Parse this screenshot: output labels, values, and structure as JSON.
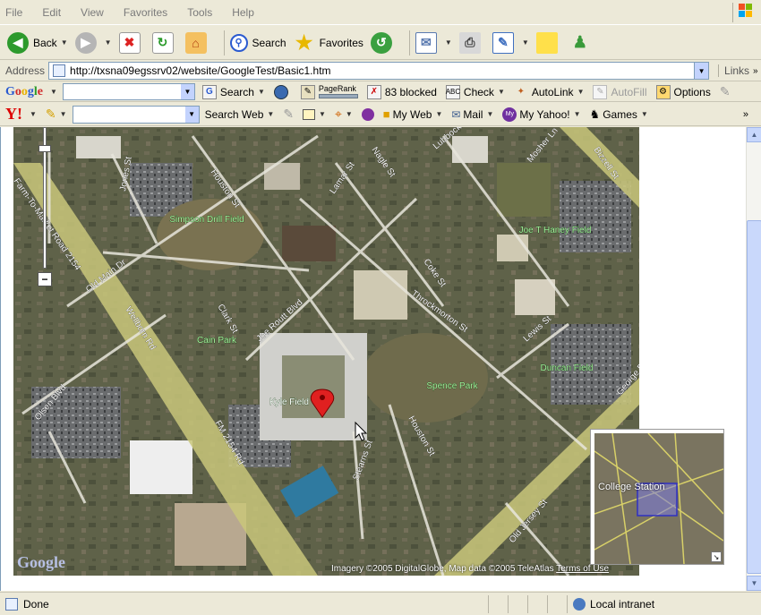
{
  "menu": [
    "File",
    "Edit",
    "View",
    "Favorites",
    "Tools",
    "Help"
  ],
  "toolbar": {
    "back_label": "Back",
    "search_label": "Search",
    "favorites_label": "Favorites"
  },
  "address": {
    "label": "Address",
    "url": "http://txsna09egssrv02/website/GoogleTest/Basic1.htm",
    "links_label": "Links"
  },
  "google_toolbar": {
    "logo": "Google",
    "search_label": "Search",
    "pagerank_label": "PageRank",
    "blocked_label": "83 blocked",
    "check_label": "Check",
    "autolink_label": "AutoLink",
    "autofill_label": "AutoFill",
    "options_label": "Options"
  },
  "yahoo_toolbar": {
    "logo": "Y!",
    "search_web_label": "Search Web",
    "my_web_label": "My Web",
    "mail_label": "Mail",
    "my_yahoo_label": "My Yahoo!",
    "games_label": "Games"
  },
  "map": {
    "streets": [
      "Houston St",
      "Jones St",
      "Nagle St",
      "Lubbock",
      "Mosher Ln",
      "Bizzell St",
      "Lamar St",
      "Farm-To-Market Road 2154",
      "Old Main Dr",
      "Coke St",
      "Throckmorton St",
      "Joe Routt Blvd",
      "Clark St",
      "Wellborn Rd",
      "Lewis St",
      "Olsen Blvd",
      "FM 2154 Rd",
      "Stearns St",
      "Houston St",
      "Old Jersey St",
      "George Bush Dr"
    ],
    "places": [
      "Simpson Drill Field",
      "Joe T Haney Field",
      "Cain Park",
      "Kyle Field",
      "Spence Park",
      "Duncan Field"
    ],
    "copyright": "Imagery ©2005 DigitalGlobe, Map data ©2005 TeleAtlas",
    "terms": "Terms of Use",
    "overview_label": "College Station",
    "logo": "Google"
  },
  "status": {
    "text": "Done",
    "zone": "Local intranet"
  }
}
